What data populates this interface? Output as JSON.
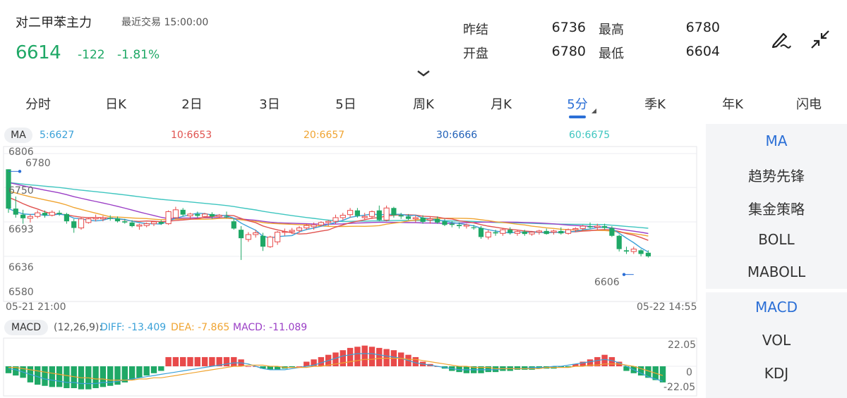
{
  "header": {
    "title": "对二甲苯主力",
    "trade_time": "最近交易 15:00:00",
    "price": "6614",
    "change": "-122",
    "change_pct": "-1.81%",
    "stats": [
      {
        "label": "昨结",
        "value": "6736"
      },
      {
        "label": "最高",
        "value": "6780"
      },
      {
        "label": "开盘",
        "value": "6780"
      },
      {
        "label": "最低",
        "value": "6604"
      }
    ],
    "icons": [
      "pen-icon",
      "collapse-icon",
      "chevron-down-icon"
    ]
  },
  "tabs": [
    "分时",
    "日K",
    "2日",
    "3日",
    "5日",
    "周K",
    "月K",
    "5分",
    "季K",
    "年K",
    "闪电"
  ],
  "active_tab": "5分",
  "indicators": {
    "main": [
      "MA",
      "趋势先锋",
      "集金策略",
      "BOLL",
      "MABOLL"
    ],
    "sub": [
      "MACD",
      "VOL",
      "KDJ"
    ],
    "active_main": "MA",
    "active_sub": "MACD"
  },
  "colors": {
    "up": "#e84a4a",
    "down": "#1fa866",
    "accent": "#2b6fd6",
    "ma5": "#3aa1d8",
    "ma10": "#e0524f",
    "ma20": "#f0a431",
    "ma30": "#2060b8",
    "ma60": "#3fc6c0",
    "ma_extra": "#9b3fc6",
    "diff": "#3aa1d8",
    "dea": "#f0a431",
    "macd": "#9b3fc6"
  },
  "chart_data": [
    {
      "type": "candlestick",
      "legend": {
        "label": "MA",
        "items": [
          "5:6627",
          "10:6653",
          "20:6657",
          "30:6666",
          "60:6675"
        ]
      },
      "y_ticks": [
        "6806",
        "6750",
        "6693",
        "6636",
        "6580"
      ],
      "ylim": [
        6580,
        6806
      ],
      "x_labels": [
        "05-21 21:00",
        "05-22 14:55"
      ],
      "high_annotation": "6780",
      "low_annotation": "6606",
      "grid": true,
      "candles": [
        [
          6780,
          6780,
          6708,
          6715
        ],
        [
          6715,
          6735,
          6700,
          6705
        ],
        [
          6705,
          6713,
          6690,
          6699
        ],
        [
          6699,
          6706,
          6692,
          6702
        ],
        [
          6702,
          6712,
          6699,
          6708
        ],
        [
          6708,
          6712,
          6700,
          6704
        ],
        [
          6704,
          6712,
          6702,
          6709
        ],
        [
          6708,
          6712,
          6703,
          6706
        ],
        [
          6706,
          6708,
          6690,
          6694
        ],
        [
          6694,
          6698,
          6675,
          6683
        ],
        [
          6683,
          6700,
          6680,
          6698
        ],
        [
          6692,
          6700,
          6690,
          6698
        ],
        [
          6698,
          6705,
          6694,
          6700
        ],
        [
          6698,
          6703,
          6694,
          6700
        ],
        [
          6700,
          6704,
          6695,
          6699
        ],
        [
          6699,
          6702,
          6692,
          6694
        ],
        [
          6694,
          6698,
          6690,
          6692
        ],
        [
          6692,
          6696,
          6684,
          6686
        ],
        [
          6686,
          6690,
          6680,
          6688
        ],
        [
          6687,
          6692,
          6684,
          6690
        ],
        [
          6690,
          6694,
          6686,
          6693
        ],
        [
          6693,
          6696,
          6688,
          6690
        ],
        [
          6690,
          6712,
          6688,
          6710
        ],
        [
          6700,
          6718,
          6698,
          6713
        ],
        [
          6713,
          6716,
          6702,
          6705
        ],
        [
          6703,
          6708,
          6698,
          6706
        ],
        [
          6706,
          6710,
          6700,
          6703
        ],
        [
          6702,
          6708,
          6700,
          6706
        ],
        [
          6706,
          6709,
          6698,
          6702
        ],
        [
          6702,
          6706,
          6699,
          6704
        ],
        [
          6702,
          6710,
          6699,
          6701
        ],
        [
          6694,
          6698,
          6680,
          6682
        ],
        [
          6680,
          6686,
          6630,
          6666
        ],
        [
          6664,
          6676,
          6660,
          6672
        ],
        [
          6672,
          6680,
          6667,
          6675
        ],
        [
          6670,
          6675,
          6645,
          6652
        ],
        [
          6652,
          6670,
          6650,
          6668
        ],
        [
          6660,
          6678,
          6655,
          6676
        ],
        [
          6676,
          6682,
          6670,
          6677
        ],
        [
          6677,
          6683,
          6673,
          6679
        ],
        [
          6679,
          6686,
          6675,
          6683
        ],
        [
          6683,
          6690,
          6680,
          6687
        ],
        [
          6685,
          6692,
          6680,
          6688
        ],
        [
          6688,
          6694,
          6685,
          6692
        ],
        [
          6692,
          6696,
          6686,
          6694
        ],
        [
          6694,
          6705,
          6690,
          6700
        ],
        [
          6700,
          6708,
          6696,
          6704
        ],
        [
          6705,
          6716,
          6700,
          6712
        ],
        [
          6712,
          6716,
          6700,
          6703
        ],
        [
          6700,
          6708,
          6696,
          6702
        ],
        [
          6702,
          6712,
          6698,
          6710
        ],
        [
          6712,
          6720,
          6694,
          6696
        ],
        [
          6696,
          6720,
          6694,
          6716
        ],
        [
          6716,
          6718,
          6700,
          6704
        ],
        [
          6704,
          6708,
          6698,
          6702
        ],
        [
          6702,
          6706,
          6696,
          6698
        ],
        [
          6698,
          6704,
          6692,
          6700
        ],
        [
          6700,
          6704,
          6690,
          6693
        ],
        [
          6696,
          6702,
          6690,
          6698
        ],
        [
          6698,
          6702,
          6690,
          6692
        ],
        [
          6694,
          6698,
          6686,
          6688
        ],
        [
          6690,
          6694,
          6684,
          6688
        ],
        [
          6688,
          6692,
          6682,
          6686
        ],
        [
          6686,
          6690,
          6682,
          6688
        ],
        [
          6684,
          6688,
          6680,
          6683
        ],
        [
          6683,
          6686,
          6665,
          6668
        ],
        [
          6668,
          6680,
          6664,
          6676
        ],
        [
          6676,
          6680,
          6670,
          6674
        ],
        [
          6674,
          6682,
          6670,
          6680
        ],
        [
          6680,
          6684,
          6672,
          6675
        ],
        [
          6674,
          6680,
          6670,
          6677
        ],
        [
          6677,
          6680,
          6670,
          6673
        ],
        [
          6673,
          6678,
          6670,
          6676
        ],
        [
          6676,
          6680,
          6672,
          6678
        ],
        [
          6678,
          6682,
          6672,
          6673
        ],
        [
          6676,
          6680,
          6672,
          6678
        ],
        [
          6678,
          6684,
          6672,
          6674
        ],
        [
          6674,
          6682,
          6672,
          6680
        ],
        [
          6680,
          6684,
          6676,
          6682
        ],
        [
          6682,
          6688,
          6678,
          6686
        ],
        [
          6686,
          6692,
          6682,
          6684
        ],
        [
          6684,
          6690,
          6680,
          6686
        ],
        [
          6686,
          6690,
          6680,
          6683
        ],
        [
          6683,
          6686,
          6668,
          6670
        ],
        [
          6670,
          6672,
          6644,
          6648
        ],
        [
          6646,
          6652,
          6640,
          6644
        ],
        [
          6644,
          6652,
          6640,
          6648
        ],
        [
          6646,
          6648,
          6636,
          6640
        ],
        [
          6642,
          6646,
          6634,
          6636
        ]
      ]
    },
    {
      "type": "bar",
      "title": "MACD",
      "params": "(12,26,9):",
      "legend": [
        "DIFF: -13.409",
        "DEA: -7.865",
        "MACD: -11.089"
      ],
      "y_ticks": [
        "22.05",
        "0",
        "-22.05"
      ],
      "ylim": [
        -22.05,
        22.05
      ],
      "values": [
        -6,
        -8,
        -10,
        -14,
        -16,
        -17,
        -18,
        -18,
        -19,
        -19,
        -20,
        -20,
        -19,
        -18,
        -17,
        -16,
        -14,
        -12,
        -10,
        -8,
        -6,
        -4,
        8,
        8,
        8,
        8,
        8,
        8,
        8,
        8,
        8,
        8,
        6,
        0,
        0,
        -2,
        -3,
        -3,
        -2,
        -1,
        0,
        4,
        6,
        8,
        10,
        12,
        14,
        16,
        17,
        18,
        17,
        16,
        15,
        14,
        12,
        10,
        8,
        4,
        2,
        0,
        -2,
        -4,
        -5,
        -6,
        -6,
        -6,
        -5,
        -5,
        -4,
        -4,
        -3,
        -3,
        -3,
        -2,
        -2,
        -2,
        -1,
        -1,
        2,
        4,
        6,
        8,
        10,
        8,
        4,
        -4,
        -6,
        -8,
        -10,
        -12,
        -14
      ],
      "diff": [
        -2,
        -3,
        -5,
        -7,
        -9,
        -11,
        -12,
        -13,
        -14,
        -14,
        -15,
        -15,
        -15,
        -14,
        -14,
        -13,
        -12,
        -11,
        -10,
        -9,
        -8,
        -7,
        -6,
        -5,
        -4,
        -3,
        -2,
        -1,
        0,
        1,
        2,
        3,
        3,
        2,
        0,
        -2,
        -3,
        -3,
        -3,
        -2,
        -1,
        0,
        1,
        3,
        5,
        7,
        9,
        10,
        11,
        11,
        11,
        10,
        9,
        8,
        7,
        5,
        3,
        2,
        1,
        0,
        -1,
        -2,
        -3,
        -3,
        -3,
        -3,
        -3,
        -3,
        -2,
        -2,
        -2,
        -2,
        -1,
        -1,
        -1,
        0,
        0,
        1,
        2,
        3,
        4,
        5,
        6,
        5,
        3,
        0,
        -3,
        -6,
        -9,
        -11,
        -13
      ],
      "dea": [
        -1,
        -1,
        -2,
        -3,
        -4,
        -5,
        -6,
        -7,
        -8,
        -9,
        -10,
        -10,
        -11,
        -11,
        -12,
        -12,
        -12,
        -12,
        -11,
        -11,
        -10,
        -10,
        -9,
        -8,
        -7,
        -6,
        -5,
        -4,
        -3,
        -2,
        -1,
        0,
        0,
        1,
        1,
        1,
        0,
        0,
        -1,
        -1,
        -1,
        -1,
        0,
        0,
        1,
        2,
        3,
        4,
        5,
        6,
        6,
        7,
        7,
        7,
        7,
        6,
        6,
        5,
        4,
        3,
        2,
        1,
        0,
        0,
        -1,
        -1,
        -1,
        -2,
        -2,
        -2,
        -2,
        -2,
        -2,
        -2,
        -1,
        -1,
        -1,
        -1,
        0,
        0,
        1,
        1,
        2,
        2,
        2,
        1,
        0,
        -2,
        -4,
        -6,
        -8
      ]
    }
  ]
}
